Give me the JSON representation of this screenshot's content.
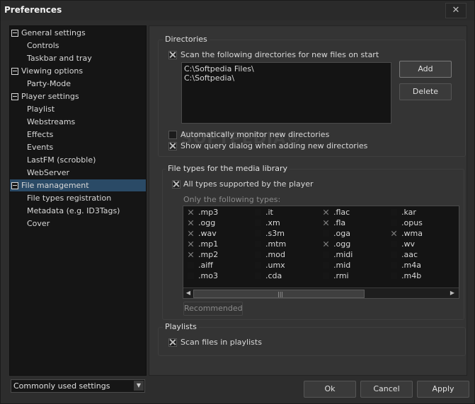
{
  "window": {
    "title": "Preferences",
    "close_glyph": "✕"
  },
  "sidebar": {
    "items": [
      {
        "label": "General settings",
        "level": 0,
        "expanded": true
      },
      {
        "label": "Controls",
        "level": 1
      },
      {
        "label": "Taskbar and tray",
        "level": 1
      },
      {
        "label": "Viewing options",
        "level": 0,
        "expanded": true
      },
      {
        "label": "Party-Mode",
        "level": 1
      },
      {
        "label": "Player settings",
        "level": 0,
        "expanded": true
      },
      {
        "label": "Playlist",
        "level": 1
      },
      {
        "label": "Webstreams",
        "level": 1
      },
      {
        "label": "Effects",
        "level": 1
      },
      {
        "label": "Events",
        "level": 1
      },
      {
        "label": "LastFM (scrobble)",
        "level": 1
      },
      {
        "label": "WebServer",
        "level": 1
      },
      {
        "label": "File management",
        "level": 0,
        "expanded": true,
        "selected": true
      },
      {
        "label": "File types registration",
        "level": 1
      },
      {
        "label": "Metadata (e.g. ID3Tags)",
        "level": 1
      },
      {
        "label": "Cover",
        "level": 1
      }
    ]
  },
  "directories": {
    "title": "Directories",
    "scan_label": "Scan the following directories for new files on start",
    "scan_checked": true,
    "paths": [
      "C:\\Softpedia Files\\",
      "C:\\Softpedia\\"
    ],
    "add_label": "Add",
    "delete_label": "Delete",
    "monitor_label": "Automatically monitor new directories",
    "monitor_checked": false,
    "query_label": "Show query dialog when adding new directories",
    "query_checked": true
  },
  "filetypes": {
    "title": "File types for the media library",
    "all_label": "All types supported by the player",
    "all_checked": true,
    "only_label": "Only the following types:",
    "columns": [
      [
        {
          "ext": ".mp3",
          "checked": true
        },
        {
          "ext": ".ogg",
          "checked": true
        },
        {
          "ext": ".wav",
          "checked": true
        },
        {
          "ext": ".mp1",
          "checked": true
        },
        {
          "ext": ".mp2",
          "checked": true
        },
        {
          "ext": ".aiff",
          "checked": false
        },
        {
          "ext": ".mo3",
          "checked": false
        }
      ],
      [
        {
          "ext": ".it",
          "checked": false
        },
        {
          "ext": ".xm",
          "checked": false
        },
        {
          "ext": ".s3m",
          "checked": false
        },
        {
          "ext": ".mtm",
          "checked": false
        },
        {
          "ext": ".mod",
          "checked": false
        },
        {
          "ext": ".umx",
          "checked": false
        },
        {
          "ext": ".cda",
          "checked": false
        }
      ],
      [
        {
          "ext": ".flac",
          "checked": true
        },
        {
          "ext": ".fla",
          "checked": true
        },
        {
          "ext": ".oga",
          "checked": false
        },
        {
          "ext": ".ogg",
          "checked": true
        },
        {
          "ext": ".midi",
          "checked": false
        },
        {
          "ext": ".mid",
          "checked": false
        },
        {
          "ext": ".rmi",
          "checked": false
        }
      ],
      [
        {
          "ext": ".kar",
          "checked": false
        },
        {
          "ext": ".opus",
          "checked": false
        },
        {
          "ext": ".wma",
          "checked": true
        },
        {
          "ext": ".wv",
          "checked": false
        },
        {
          "ext": ".aac",
          "checked": false
        },
        {
          "ext": ".m4a",
          "checked": false
        },
        {
          "ext": ".m4b",
          "checked": false
        }
      ]
    ],
    "recommended_label": "Recommended"
  },
  "playlists": {
    "title": "Playlists",
    "scan_label": "Scan files in playlists",
    "scan_checked": true
  },
  "footer": {
    "dropdown_value": "Commonly used settings",
    "ok_label": "Ok",
    "cancel_label": "Cancel",
    "apply_label": "Apply"
  },
  "watermark_text": "SOFTPEDIA®"
}
